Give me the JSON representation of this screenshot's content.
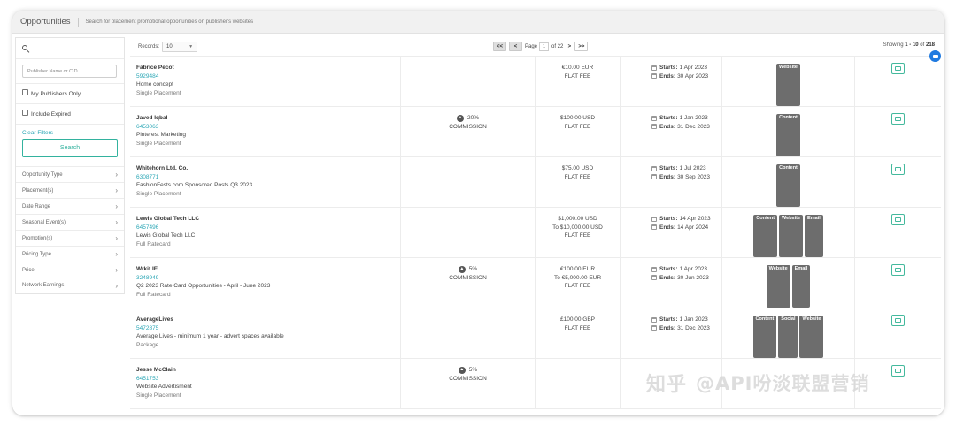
{
  "header": {
    "title": "Opportunities",
    "subtitle": "Search for placement promotional opportunities on publisher's websites"
  },
  "sidebar": {
    "search_icon": "search-icon",
    "publisher_placeholder": "Publisher Name or CID",
    "my_publishers_label": "My Publishers Only",
    "include_expired_label": "Include Expired",
    "clear_filters": "Clear Filters",
    "search_button": "Search",
    "facets": [
      {
        "label": "Opportunity Type"
      },
      {
        "label": "Placement(s)"
      },
      {
        "label": "Date Range"
      },
      {
        "label": "Seasonal Event(s)"
      },
      {
        "label": "Promotion(s)"
      },
      {
        "label": "Pricing Type"
      },
      {
        "label": "Price"
      },
      {
        "label": "Network Earnings"
      }
    ]
  },
  "pager": {
    "records_label": "Records:",
    "records_value": "10",
    "first": "<<",
    "prev": "<",
    "page_label": "Page",
    "page_value": "1",
    "of_label": "of 22",
    "next": ">",
    "last": ">>",
    "showing_prefix": "Showing ",
    "showing_range": "1 - 10",
    "showing_of": " of ",
    "showing_total": "218"
  },
  "rows": [
    {
      "publisher": "Fabrice Pecot",
      "id": "5929484",
      "description": "Home concept",
      "placement_type": "Single Placement",
      "commission": null,
      "price_lines": [
        "€10.00 EUR",
        "FLAT FEE"
      ],
      "starts": "1 Apr 2023",
      "ends": "30 Apr 2023",
      "badges": [
        "Website"
      ]
    },
    {
      "publisher": "Javed Iqbal",
      "id": "6453063",
      "description": "Pinterest Marketing",
      "placement_type": "Single Placement",
      "commission": {
        "value": "20%",
        "label": "COMMISSION"
      },
      "price_lines": [
        "$100.00 USD",
        "FLAT FEE"
      ],
      "starts": "1 Jan 2023",
      "ends": "31 Dec 2023",
      "badges": [
        "Content"
      ]
    },
    {
      "publisher": "Whitehorn Ltd. Co.",
      "id": "6308771",
      "description": "FashionFests.com Sponsored Posts Q3 2023",
      "placement_type": "Single Placement",
      "commission": null,
      "price_lines": [
        "$75.00 USD",
        "FLAT FEE"
      ],
      "starts": "1 Jul 2023",
      "ends": "30 Sep 2023",
      "badges": [
        "Content"
      ]
    },
    {
      "publisher": "Lewis Global Tech LLC",
      "id": "6457496",
      "description": "Lewis Global Tech LLC",
      "placement_type": "Full Ratecard",
      "commission": null,
      "price_lines": [
        "$1,000.00 USD",
        "To $10,000.00 USD",
        "FLAT FEE"
      ],
      "starts": "14 Apr 2023",
      "ends": "14 Apr 2024",
      "badges": [
        "Content",
        "Website",
        "Email"
      ]
    },
    {
      "publisher": "Wrkit IE",
      "id": "3248949",
      "description": "Q2 2023 Rate Card Opportunities - April - June 2023",
      "placement_type": "Full Ratecard",
      "commission": {
        "value": "5%",
        "label": "COMMISSION"
      },
      "price_lines": [
        "€100.00 EUR",
        "To €5,000.00 EUR",
        "FLAT FEE"
      ],
      "starts": "1 Apr 2023",
      "ends": "30 Jun 2023",
      "badges": [
        "Website",
        "Email"
      ]
    },
    {
      "publisher": "AverageLives",
      "id": "5472875",
      "description": "Average Lives - minimum 1 year - advert spaces available",
      "placement_type": "Package",
      "commission": null,
      "price_lines": [
        "£100.00 GBP",
        "FLAT FEE"
      ],
      "starts": "1 Jan 2023",
      "ends": "31 Dec 2023",
      "badges": [
        "Content",
        "Social",
        "Website"
      ]
    },
    {
      "publisher": "Jesse McClain",
      "id": "6451753",
      "description": "Website Advertisment",
      "placement_type": "Single Placement",
      "commission": {
        "value": "5%",
        "label": "COMMISSION"
      },
      "price_lines": [],
      "starts": "",
      "ends": "",
      "badges": []
    }
  ],
  "date_labels": {
    "starts": "Starts:",
    "ends": "Ends:"
  },
  "watermark": {
    "part1": "知乎",
    "part2": "@API吩淡联盟营销"
  },
  "colors": {
    "accent": "#2aa6b5",
    "button_green": "#33b29e",
    "badge": "#6d6d6d",
    "chat": "#1f7ae0"
  }
}
